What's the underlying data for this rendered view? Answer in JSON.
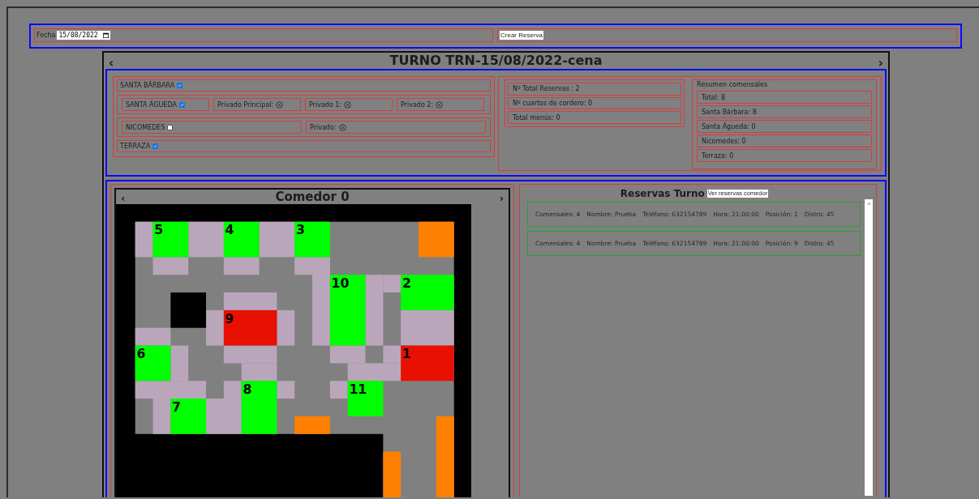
{
  "header": {
    "date_label": "Fecha",
    "date_value": "15/08/2022",
    "create_button": "Crear Reserva"
  },
  "turno": {
    "prev": "‹",
    "title": "TURNO TRN-15/08/2022-cena",
    "next": "›"
  },
  "room_rows": [
    {
      "items": [
        {
          "kind": "check",
          "label": "SANTA BÁRBARA",
          "checked": true
        }
      ]
    },
    {
      "items": [
        {
          "kind": "check",
          "label": "SANTA ÁGUEDA",
          "checked": true
        },
        {
          "kind": "private",
          "label": "Privado Principal:"
        },
        {
          "kind": "private",
          "label": "Privado 1:"
        },
        {
          "kind": "private",
          "label": "Privado 2:"
        }
      ]
    },
    {
      "items": [
        {
          "kind": "check",
          "label": "NICOMEDES",
          "checked": false
        },
        {
          "kind": "private",
          "label": "Privado:"
        }
      ]
    },
    {
      "items": [
        {
          "kind": "check",
          "label": "TERRAZA",
          "checked": true
        }
      ]
    }
  ],
  "totals": [
    "Nº Total Reservas : 2",
    "Nº cuartos de cordero: 0",
    "Total menús: 0"
  ],
  "summary": {
    "title": "Resumen comensales",
    "items": [
      "Total: 8",
      "Santa Bárbara: 8",
      "Santa Águeda: 0",
      "Nicomedes: 0",
      "Terraza: 0"
    ]
  },
  "comedor": {
    "prev": "‹",
    "title": "Comedor 0",
    "next": "›",
    "tables": [
      {
        "number": "5",
        "color": "#00ff00"
      },
      {
        "number": "4",
        "color": "#00ff00"
      },
      {
        "number": "3",
        "color": "#00ff00"
      },
      {
        "number": "10",
        "color": "#00ff00"
      },
      {
        "number": "2",
        "color": "#00ff00"
      },
      {
        "number": "9",
        "color": "#e81000"
      },
      {
        "number": "6",
        "color": "#00ff00"
      },
      {
        "number": "1",
        "color": "#e81000"
      },
      {
        "number": "8",
        "color": "#00ff00"
      },
      {
        "number": "11",
        "color": "#00ff00"
      },
      {
        "number": "7",
        "color": "#00ff00"
      }
    ]
  },
  "reservations": {
    "title": "Reservas Turno",
    "button": "Ver reservas comedor",
    "items": [
      {
        "fields": [
          "Comensales: 4",
          "Nombre: Prueba",
          "Teléfono: 632154789",
          "Hora: 21:00:00",
          "Posición: 1",
          "Distro: 45"
        ]
      },
      {
        "fields": [
          "Comensales: 4",
          "Nombre: Prueba",
          "Teléfono: 632154789",
          "Hora: 21:00:00",
          "Posición: 9",
          "Distro: 45"
        ]
      }
    ]
  }
}
